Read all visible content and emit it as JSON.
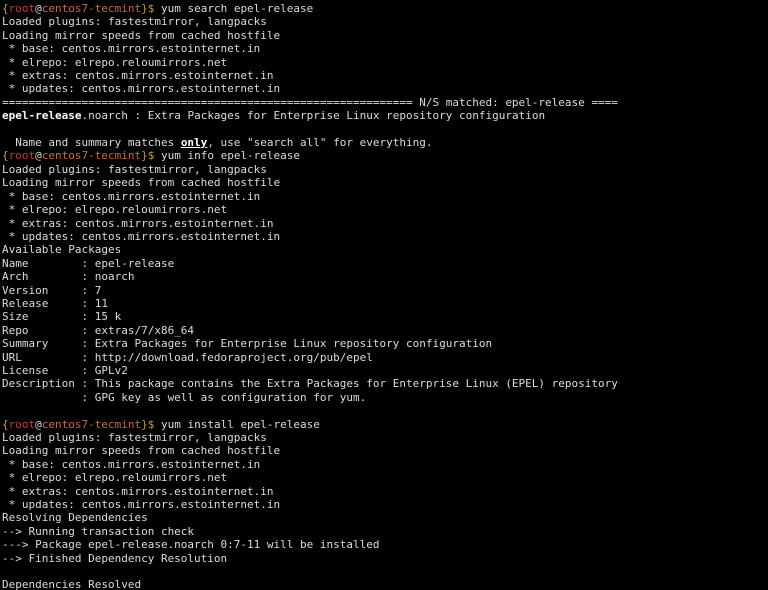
{
  "prompt": {
    "lbrace": "{",
    "rbrace": "}",
    "user": "root",
    "at": "@",
    "host": "centos7-tecmint",
    "dollar": "$ "
  },
  "cmd": {
    "search": "yum search epel-release",
    "info": "yum info epel-release",
    "install": "yum install epel-release"
  },
  "common": {
    "loaded": "Loaded plugins: fastestmirror, langpacks",
    "loading": "Loading mirror speeds from cached hostfile",
    "base": " * base: centos.mirrors.estointernet.in",
    "elrepo": " * elrepo: elrepo.reloumirrors.net",
    "extras": " * extras: centos.mirrors.estointernet.in",
    "updates": " * updates: centos.mirrors.estointernet.in"
  },
  "search": {
    "sep_left": "============================================================== N/S matched: epel-release ====",
    "result_pkg": "epel-release",
    "result_rest": ".noarch : Extra Packages for Enterprise Linux repository configuration",
    "hint_pre": "  Name and summary matches ",
    "hint_only": "only",
    "hint_post": ", use \"search all\" for everything."
  },
  "info": {
    "avail": "Available Packages",
    "name": "Name        : epel-release",
    "arch": "Arch        : noarch",
    "version": "Version     : 7",
    "release": "Release     : 11",
    "size": "Size        : 15 k",
    "repo": "Repo        : extras/7/x86_64",
    "summary": "Summary     : Extra Packages for Enterprise Linux repository configuration",
    "url": "URL         : http://download.fedoraproject.org/pub/epel",
    "license": "License     : GPLv2",
    "desc1": "Description : This package contains the Extra Packages for Enterprise Linux (EPEL) repository",
    "desc2": "            : GPG key as well as configuration for yum."
  },
  "install": {
    "resolving": "Resolving Dependencies",
    "l1": "--> Running transaction check",
    "l2": "---> Package epel-release.noarch 0:7-11 will be installed",
    "l3": "--> Finished Dependency Resolution",
    "depres": "Dependencies Resolved"
  }
}
